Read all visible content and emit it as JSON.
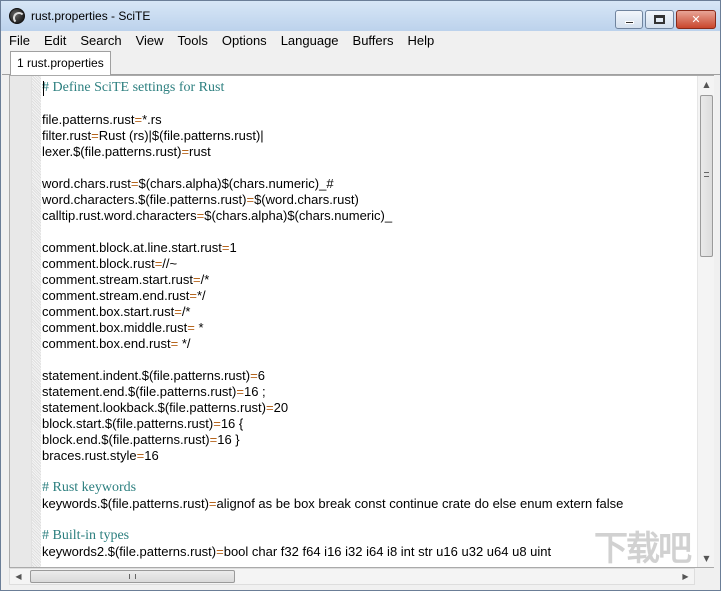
{
  "window": {
    "title": "rust.properties - SciTE",
    "minimize_glyph": "",
    "maximize_glyph": "",
    "close_glyph": "✕"
  },
  "menubar": {
    "items": [
      "File",
      "Edit",
      "Search",
      "View",
      "Tools",
      "Options",
      "Language",
      "Buffers",
      "Help"
    ]
  },
  "tabs": [
    {
      "label": "1 rust.properties"
    }
  ],
  "editor": {
    "lines": [
      {
        "type": "comment",
        "text": "# Define SciTE settings for Rust"
      },
      {
        "type": "blank",
        "text": ""
      },
      {
        "type": "prop",
        "key": "file.patterns.rust",
        "value": "*.rs"
      },
      {
        "type": "prop",
        "key": "filter.rust",
        "value": "Rust (rs)|$(file.patterns.rust)|"
      },
      {
        "type": "prop",
        "key": "lexer.$(file.patterns.rust)",
        "value": "rust"
      },
      {
        "type": "blank",
        "text": ""
      },
      {
        "type": "prop",
        "key": "word.chars.rust",
        "value": "$(chars.alpha)$(chars.numeric)_#"
      },
      {
        "type": "prop",
        "key": "word.characters.$(file.patterns.rust)",
        "value": "$(word.chars.rust)"
      },
      {
        "type": "prop",
        "key": "calltip.rust.word.characters",
        "value": "$(chars.alpha)$(chars.numeric)_"
      },
      {
        "type": "blank",
        "text": ""
      },
      {
        "type": "prop",
        "key": "comment.block.at.line.start.rust",
        "value": "1"
      },
      {
        "type": "prop",
        "key": "comment.block.rust",
        "value": "//~"
      },
      {
        "type": "prop",
        "key": "comment.stream.start.rust",
        "value": "/*"
      },
      {
        "type": "prop",
        "key": "comment.stream.end.rust",
        "value": "*/"
      },
      {
        "type": "prop",
        "key": "comment.box.start.rust",
        "value": "/*"
      },
      {
        "type": "prop",
        "key": "comment.box.middle.rust",
        "value": " *"
      },
      {
        "type": "prop",
        "key": "comment.box.end.rust",
        "value": " */"
      },
      {
        "type": "blank",
        "text": ""
      },
      {
        "type": "prop",
        "key": "statement.indent.$(file.patterns.rust)",
        "value": "6"
      },
      {
        "type": "prop",
        "key": "statement.end.$(file.patterns.rust)",
        "value": "16 ;"
      },
      {
        "type": "prop",
        "key": "statement.lookback.$(file.patterns.rust)",
        "value": "20"
      },
      {
        "type": "prop",
        "key": "block.start.$(file.patterns.rust)",
        "value": "16 {"
      },
      {
        "type": "prop",
        "key": "block.end.$(file.patterns.rust)",
        "value": "16 }"
      },
      {
        "type": "prop",
        "key": "braces.rust.style",
        "value": "16"
      },
      {
        "type": "blank",
        "text": ""
      },
      {
        "type": "comment",
        "text": "# Rust keywords"
      },
      {
        "type": "prop",
        "key": "keywords.$(file.patterns.rust)",
        "value": "alignof as be box break const continue crate do else enum extern false"
      },
      {
        "type": "blank",
        "text": ""
      },
      {
        "type": "comment",
        "text": "# Built-in types"
      },
      {
        "type": "prop",
        "key": "keywords2.$(file.patterns.rust)",
        "value": "bool char f32 f64 i16 i32 i64 i8 int str u16 u32 u64 u8 uint"
      }
    ]
  },
  "scroll": {
    "up_glyph": "▲",
    "down_glyph": "▼",
    "left_glyph": "◀",
    "right_glyph": "▶"
  },
  "watermark": "下载吧"
}
